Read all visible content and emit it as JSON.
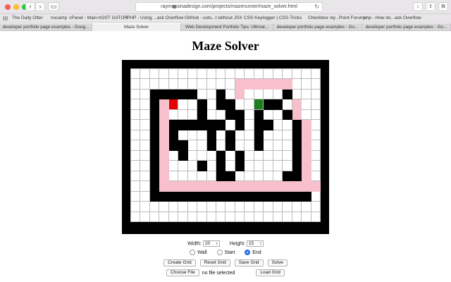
{
  "browser": {
    "url": "raymessinadesign.com/projects/mazerunner/maze_solver.html",
    "bookmarks": [
      "The Daily Otter",
      "nucamp",
      "cPanel - Main-hOST GATOR",
      "PHP - Using ...ack Overflow",
      "GitHub - ustu...t without JSX",
      "CSS Keylogger | CSS-Tricks",
      "Checkbox sty...Point Forums",
      "php - How do...ack Overflow"
    ],
    "tabs": [
      {
        "label": "developer portfolio page examples - Goog...",
        "active": false
      },
      {
        "label": "Maze Solver",
        "active": true
      },
      {
        "label": "Web Development Portfolio Tips: Ultimat...",
        "active": false
      },
      {
        "label": "developer portfolio page examples - Go...",
        "active": false
      },
      {
        "label": "developer portfolio page examples - Go...",
        "active": false
      }
    ]
  },
  "page": {
    "title": "Maze Solver"
  },
  "maze": {
    "cols": 20,
    "rows": 15,
    "legend": {
      ".": "empty",
      "#": "wall",
      "p": "solution-path",
      "S": "start",
      "E": "end"
    },
    "grid": [
      "....................",
      "...........pppppp...",
      "..#####..#.p....#...",
      "..#pS..#.##..E##.p..",
      "..#p...#..##.#..#p..",
      "..#p######.#.##..#p.",
      "..#p#...#.#..#...#p.",
      "..#p##..#.#..#...#p.",
      "..#p.#...#.#.....#p.",
      "..#p...#.#.#.....#p.",
      "..#p.....##.....##p.",
      "..#ppppppppppppppppp.",
      "..#################.",
      "....................",
      "...................."
    ],
    "colors": {
      "wall": "#000000",
      "path": "#f8c0cc",
      "start": "#e50000",
      "end": "#1c7d1c",
      "frame": "#000000"
    }
  },
  "controls": {
    "width_label": "Width:",
    "width_value": "20",
    "height_label": "Height:",
    "height_value": "15",
    "modes": [
      {
        "label": "Wall",
        "checked": false
      },
      {
        "label": "Start",
        "checked": false
      },
      {
        "label": "End",
        "checked": true
      }
    ],
    "buttons": {
      "create": "Create Grid",
      "reset": "Reset Grid",
      "save": "Save Grid",
      "solve": "Solve",
      "choose_file": "Choose File",
      "load": "Load Grid"
    },
    "file_status": "no file selected"
  }
}
